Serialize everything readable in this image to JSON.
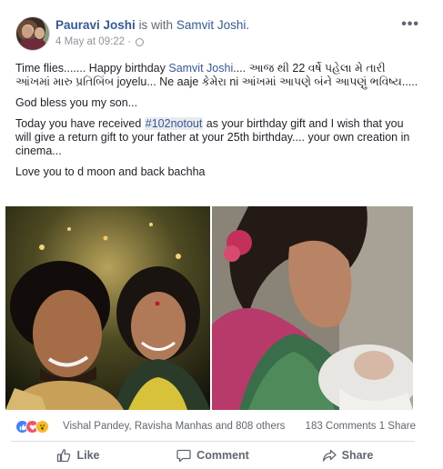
{
  "post": {
    "author": "Pauravi Joshi",
    "with_text": "is with",
    "tagged": "Samvit Joshi.",
    "timestamp": "4 May at 09:22 ·",
    "more_label": "•••",
    "line1_a": "Time flies....... Happy birthday ",
    "line1_link": "Samvit Joshi",
    "line1_b": ".... આજ થી 22 વર્ષે પહેલા મે તારી આંખમાં મારુ પ્રતિબિંબ joyelu... Ne aaje કેમેરા ni આંખમાં આપણે બંને આપણું ભવિષ્ય.....",
    "line2": "God bless you my son...",
    "line3_a": "Today you have received ",
    "line3_hashtag": "#102notout",
    "line3_b": " as your birthday gift and I wish that you will give a return gift to your father at your 25th birthday.... your own creation in cinema...",
    "line4": "Love you to d moon and back bachha"
  },
  "reactions": {
    "icons": [
      "like-icon",
      "love-icon",
      "wow-icon"
    ],
    "names": "Vishal Pandey, Ravisha Manhas and 808 others",
    "counts": "183 Comments  1 Share"
  },
  "actions": {
    "like": "Like",
    "comment": "Comment",
    "share": "Share"
  },
  "colors": {
    "link": "#365899",
    "meta": "#90949c",
    "like_blue": "#4080ff",
    "love_red": "#f25268",
    "wow_yellow": "#f7b928"
  }
}
